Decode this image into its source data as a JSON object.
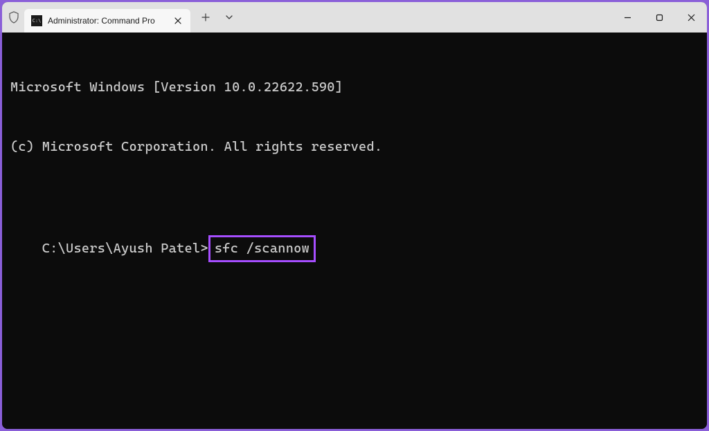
{
  "tab": {
    "title": "Administrator: Command Pro"
  },
  "terminal": {
    "line1": "Microsoft Windows [Version 10.0.22622.590]",
    "line2": "(c) Microsoft Corporation. All rights reserved.",
    "prompt": "C:\\Users\\Ayush Patel>",
    "command": "sfc /scannow"
  },
  "highlight_color": "#a64eff"
}
